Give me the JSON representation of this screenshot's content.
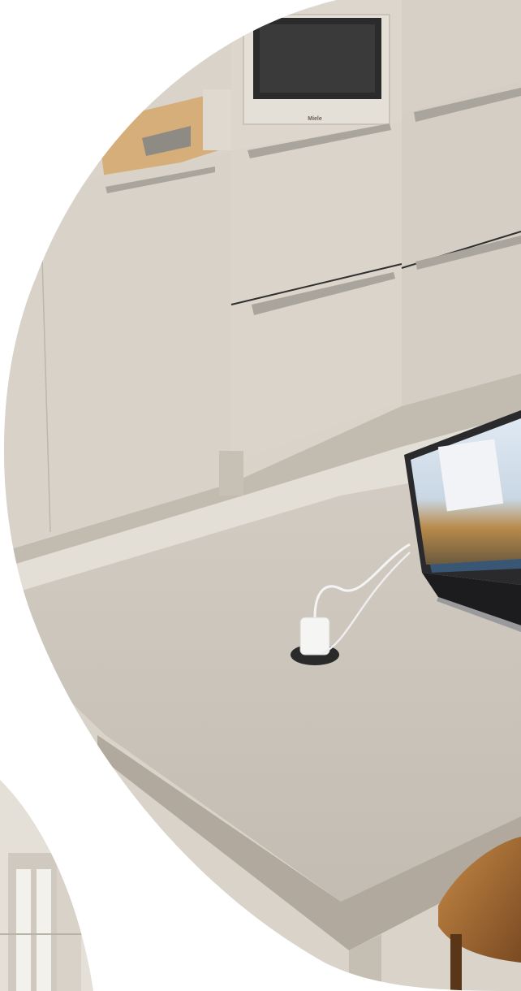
{
  "scene": {
    "subject": "kitchen-photo",
    "oven_brand": "Miele",
    "colors": {
      "background": "#ffffff",
      "cabinet": "#d9d3ca",
      "cabinet_shadow": "#c9c2b7",
      "countertop": "#c8c1b7",
      "countertop_edge": "#b1a99d",
      "floor": "#e3ded6",
      "handle": "#a9a49c",
      "wood": "#d6ae7a",
      "laptop_body": "#2a2a2c",
      "chair": "#b2773a"
    }
  }
}
